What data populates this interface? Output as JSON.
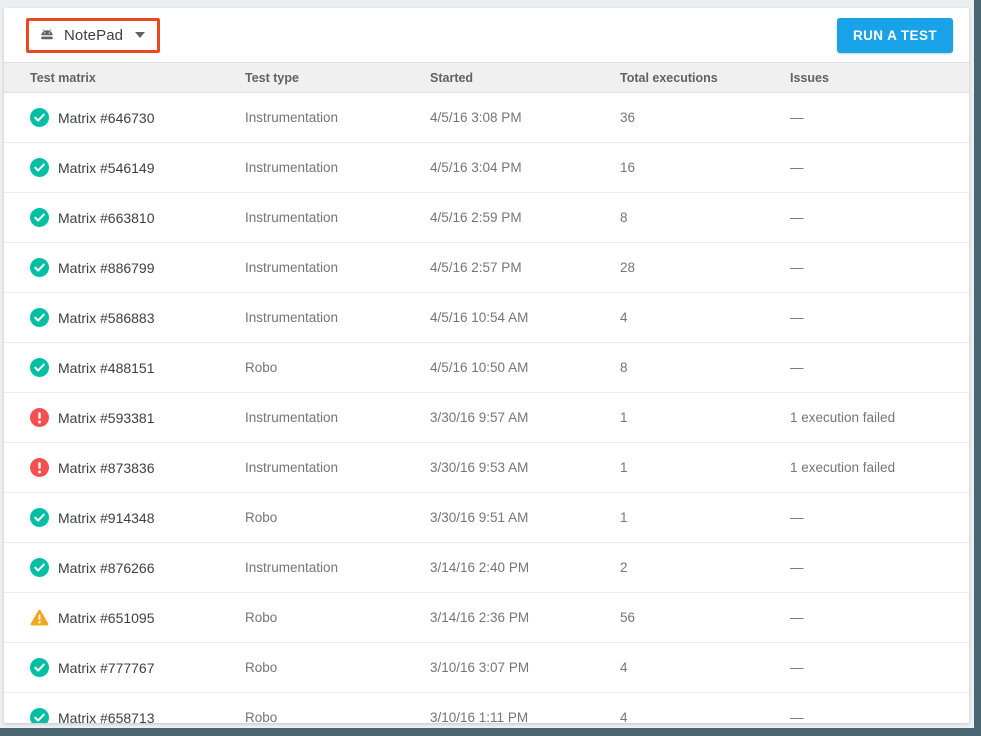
{
  "colors": {
    "accent_blue": "#18A2E8",
    "annotation_orange": "#E8491D",
    "success_teal": "#00BFA5",
    "error_red": "#F4504F",
    "warning_amber": "#F5A623",
    "frame_slate": "#4A6572",
    "page_bg": "#ECEFF1"
  },
  "icons": {
    "app_selector": "android-robot-head",
    "app_selector_caret": "chevron-down",
    "success": "check-circle",
    "error": "exclamation-circle",
    "warning": "exclamation-triangle"
  },
  "toolbar": {
    "app_selector_label": "NotePad",
    "run_test_label": "RUN A TEST"
  },
  "table": {
    "headers": [
      "Test matrix",
      "Test type",
      "Started",
      "Total executions",
      "Issues"
    ],
    "rows": [
      {
        "status": "success",
        "name": "Matrix #646730",
        "type": "Instrumentation",
        "started": "4/5/16 3:08 PM",
        "total": "36",
        "issues": "—"
      },
      {
        "status": "success",
        "name": "Matrix #546149",
        "type": "Instrumentation",
        "started": "4/5/16 3:04 PM",
        "total": "16",
        "issues": "—"
      },
      {
        "status": "success",
        "name": "Matrix #663810",
        "type": "Instrumentation",
        "started": "4/5/16 2:59 PM",
        "total": "8",
        "issues": "—"
      },
      {
        "status": "success",
        "name": "Matrix #886799",
        "type": "Instrumentation",
        "started": "4/5/16 2:57 PM",
        "total": "28",
        "issues": "—"
      },
      {
        "status": "success",
        "name": "Matrix #586883",
        "type": "Instrumentation",
        "started": "4/5/16 10:54 AM",
        "total": "4",
        "issues": "—"
      },
      {
        "status": "success",
        "name": "Matrix #488151",
        "type": "Robo",
        "started": "4/5/16 10:50 AM",
        "total": "8",
        "issues": "—"
      },
      {
        "status": "error",
        "name": "Matrix #593381",
        "type": "Instrumentation",
        "started": "3/30/16 9:57 AM",
        "total": "1",
        "issues": "1 execution failed"
      },
      {
        "status": "error",
        "name": "Matrix #873836",
        "type": "Instrumentation",
        "started": "3/30/16 9:53 AM",
        "total": "1",
        "issues": "1 execution failed"
      },
      {
        "status": "success",
        "name": "Matrix #914348",
        "type": "Robo",
        "started": "3/30/16 9:51 AM",
        "total": "1",
        "issues": "—"
      },
      {
        "status": "success",
        "name": "Matrix #876266",
        "type": "Instrumentation",
        "started": "3/14/16 2:40 PM",
        "total": "2",
        "issues": "—"
      },
      {
        "status": "warning",
        "name": "Matrix #651095",
        "type": "Robo",
        "started": "3/14/16 2:36 PM",
        "total": "56",
        "issues": "—"
      },
      {
        "status": "success",
        "name": "Matrix #777767",
        "type": "Robo",
        "started": "3/10/16 3:07 PM",
        "total": "4",
        "issues": "—"
      },
      {
        "status": "success",
        "name": "Matrix #658713",
        "type": "Robo",
        "started": "3/10/16 1:11 PM",
        "total": "4",
        "issues": "—"
      }
    ]
  }
}
